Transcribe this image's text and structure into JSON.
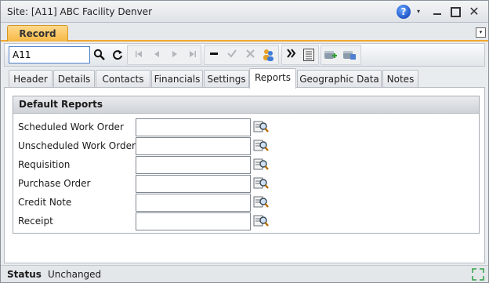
{
  "window": {
    "title": "Site: [A11] ABC Facility Denver",
    "help_glyph": "?",
    "dropdown_glyph": "▾",
    "close_glyph": "✕"
  },
  "record_tab": {
    "label": "Record",
    "menu_glyph": "▾"
  },
  "toolbar": {
    "code_value": "A11",
    "search_icon": "magnifier-icon",
    "refresh_icon": "refresh-icon"
  },
  "tabs": [
    {
      "label": "Header"
    },
    {
      "label": "Details"
    },
    {
      "label": "Contacts"
    },
    {
      "label": "Financials"
    },
    {
      "label": "Settings"
    },
    {
      "label": "Reports",
      "active": true
    },
    {
      "label": "Geographic Data"
    },
    {
      "label": "Notes"
    }
  ],
  "reports": {
    "group_title": "Default Reports",
    "rows": [
      {
        "label": "Scheduled Work Order",
        "value": ""
      },
      {
        "label": "Unscheduled Work Order",
        "value": ""
      },
      {
        "label": "Requisition",
        "value": ""
      },
      {
        "label": "Purchase Order",
        "value": ""
      },
      {
        "label": "Credit Note",
        "value": ""
      },
      {
        "label": "Receipt",
        "value": ""
      }
    ]
  },
  "status": {
    "label": "Status",
    "value": "Unchanged"
  },
  "colors": {
    "accent": "#f6b845",
    "tab_border": "#b7bcc3"
  }
}
